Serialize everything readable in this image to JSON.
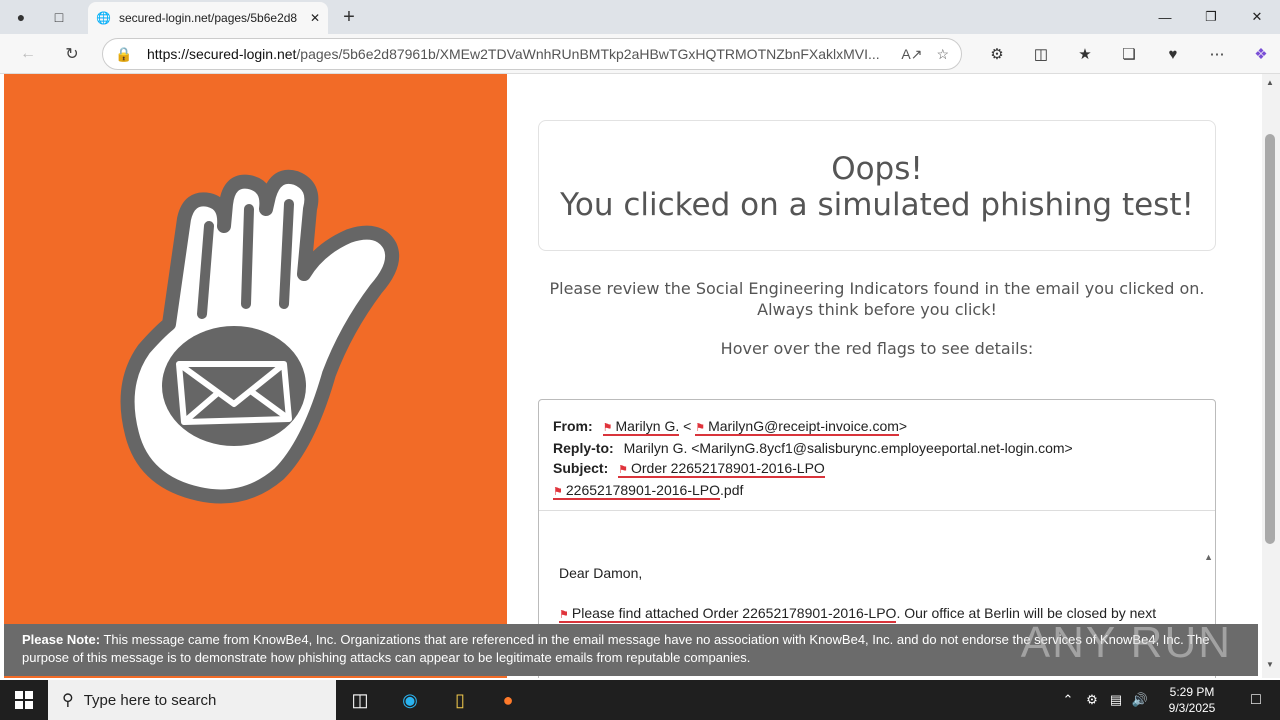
{
  "browser": {
    "tab_title": "secured-login.net/pages/5b6e2d8",
    "url_host": "https://secured-login.net",
    "url_path": "/pages/5b6e2d87961b/XMEw2TDVaWnhRUnBMTkp2aHBwTGxHQTRMOTNZbnFXaklxMVI..."
  },
  "page": {
    "oops_line1": "Oops!",
    "oops_line2": "You clicked on a simulated phishing test!",
    "review_line1": "Please review the Social Engineering Indicators found in the email you clicked on.",
    "review_line2": "Always think before you click!",
    "hover_text": "Hover over the red flags to see details:",
    "email": {
      "from_label": "From:",
      "from_name": "Marilyn G.",
      "from_lt": "<",
      "from_email": "MarilynG@receipt-invoice.com",
      "from_gt": ">",
      "replyto_label": "Reply-to:",
      "replyto_value": "Marilyn G. <MarilynG.8ycf1@salisburync.employeeportal.net-login.com>",
      "subject_label": "Subject:",
      "subject_value": "Order 22652178901-2016-LPO",
      "attachment_name": "22652178901-2016-LPO",
      "attachment_ext": ".pdf",
      "greeting": "Dear Damon,",
      "body_flagged": "Please find attached Order 22652178901-2016-LPO",
      "body_rest": ". Our office at Berlin will be closed by next"
    },
    "note_label": "Please Note:",
    "note_text": "This message came from KnowBe4, Inc. Organizations that are referenced in the email message have no association with KnowBe4, Inc. and do not endorse the services of KnowBe4, Inc. The purpose of this message is to demonstrate how phishing attacks can appear to be legitimate emails from reputable companies.",
    "watermark": "ANY RUN"
  },
  "taskbar": {
    "search_placeholder": "Type here to search",
    "time": "5:29 PM",
    "date": "9/3/2025"
  },
  "colors": {
    "accent_orange": "#f26b27",
    "flag_red": "#e0333b"
  }
}
